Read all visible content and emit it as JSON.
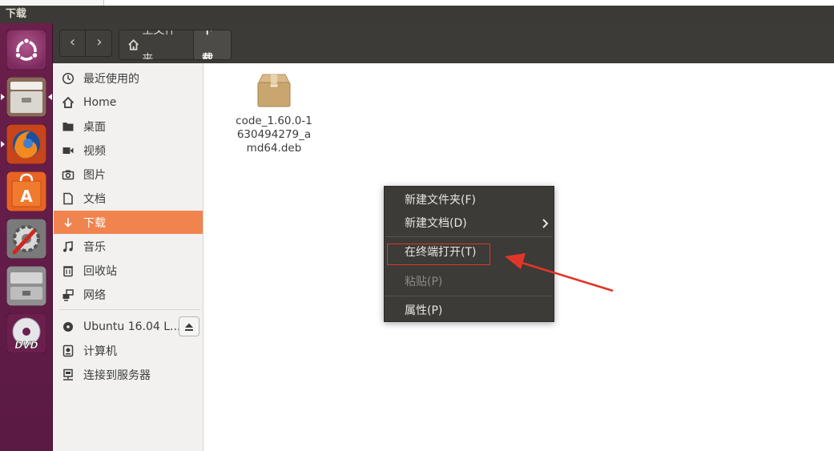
{
  "window": {
    "title": "下载"
  },
  "toolbar": {
    "back_symbol": "‹",
    "forward_symbol": "›",
    "breadcrumbs": [
      {
        "label": "主文件夹",
        "icon": "home-icon"
      },
      {
        "label": "下载"
      }
    ]
  },
  "sidebar": {
    "items": [
      {
        "label": "最近使用的",
        "icon": "clock-icon"
      },
      {
        "label": "Home",
        "icon": "home-icon"
      },
      {
        "label": "桌面",
        "icon": "folder-icon"
      },
      {
        "label": "视频",
        "icon": "video-icon"
      },
      {
        "label": "图片",
        "icon": "camera-icon"
      },
      {
        "label": "文档",
        "icon": "document-icon"
      },
      {
        "label": "下载",
        "icon": "download-icon",
        "active": true
      },
      {
        "label": "音乐",
        "icon": "music-icon"
      },
      {
        "label": "回收站",
        "icon": "trash-icon"
      },
      {
        "label": "网络",
        "icon": "network-icon"
      }
    ],
    "devices": [
      {
        "label": "Ubuntu 16.04 L...",
        "icon": "disc-icon"
      },
      {
        "label": "计算机",
        "icon": "computer-icon"
      },
      {
        "label": "连接到服务器",
        "icon": "server-icon"
      }
    ]
  },
  "files": [
    {
      "name": "code_1.60.0-1630494279_amd64.deb",
      "icon": "package-icon"
    }
  ],
  "context_menu": {
    "items": [
      {
        "label": "新建文件夹(F)"
      },
      {
        "label": "新建文档(D)",
        "has_submenu": true
      },
      {
        "label": "在终端打开(T)",
        "highlighted": true
      },
      {
        "label": "粘贴(P)",
        "disabled": true
      },
      {
        "label": "属性(P)"
      }
    ]
  },
  "colors": {
    "accent": "#f0844e",
    "launcher": "#5e1b46",
    "toolbar": "#3c3b37",
    "annotation": "#e2352a"
  }
}
